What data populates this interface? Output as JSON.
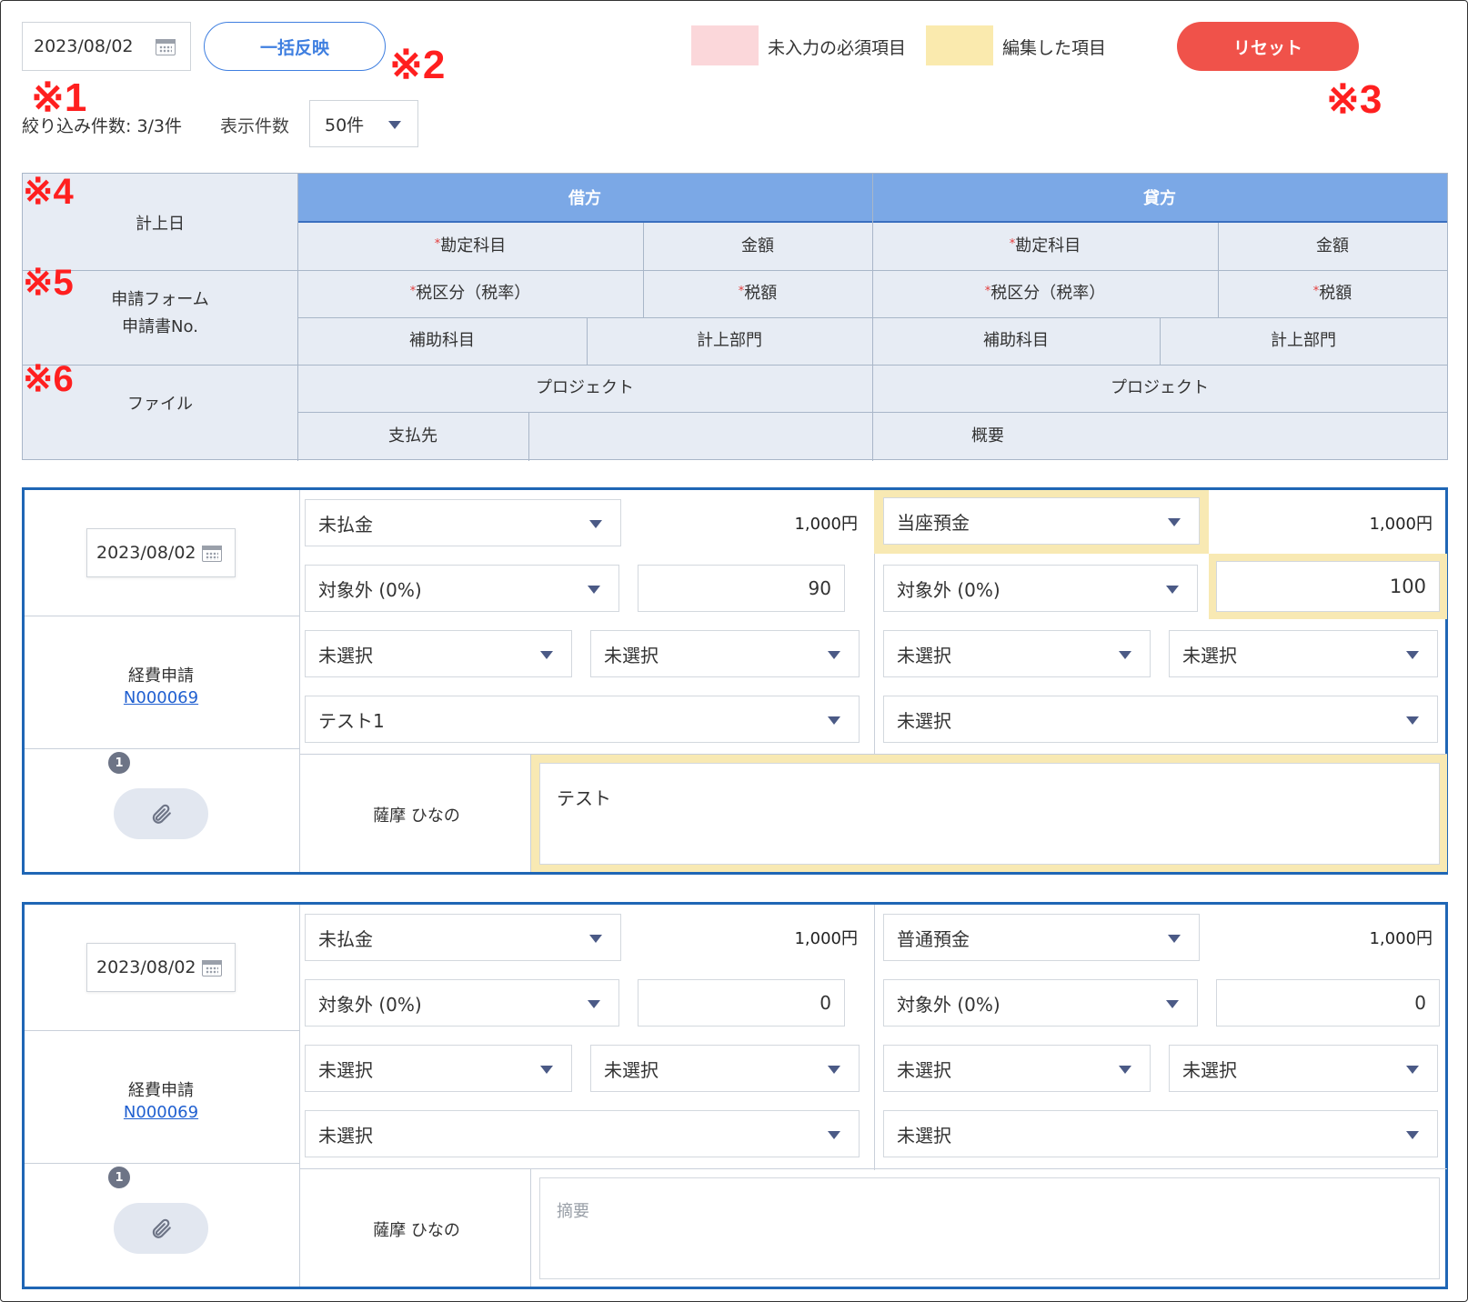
{
  "toolbar": {
    "bulk_date": "2023/08/02",
    "bulk_apply_label": "一括反映",
    "legend_required_label": "未入力の必須項目",
    "legend_edited_label": "編集した項目",
    "reset_label": "リセット",
    "filter_count": "絞り込み件数: 3/3件",
    "display_count_label": "表示件数",
    "display_count_value": "50件"
  },
  "notes": {
    "n1": "※1",
    "n2": "※2",
    "n3": "※3",
    "n4": "※4",
    "n5": "※5",
    "n6": "※6"
  },
  "colors": {
    "required": "#fbd7da",
    "edited": "#faeaae",
    "reset": "#f0524a",
    "accent": "#3f7fe0",
    "header_blue": "#7ba8e6"
  },
  "header": {
    "posting_date": "計上日",
    "debit": "借方",
    "credit": "貸方",
    "account": "勘定科目",
    "amount": "金額",
    "tax_category": "税区分（税率）",
    "tax_amount": "税額",
    "sub_account": "補助科目",
    "department": "計上部門",
    "form_line1": "申請フォーム",
    "form_line2": "申請書No.",
    "project": "プロジェクト",
    "file": "ファイル",
    "payee": "支払先",
    "summary": "概要",
    "required_mark": "*"
  },
  "rows": [
    {
      "date": "2023/08/02",
      "form_type": "経費申請",
      "form_no": "N000069",
      "attachment_count": "1",
      "debit": {
        "account": "未払金",
        "amount": "1,000円",
        "tax_category": "対象外 (0%)",
        "tax_amount": "90",
        "sub_account": "未選択",
        "department": "未選択",
        "project": "テスト1"
      },
      "credit": {
        "account": "当座預金",
        "amount": "1,000円",
        "tax_category": "対象外 (0%)",
        "tax_amount": "100",
        "sub_account": "未選択",
        "department": "未選択",
        "project": "未選択"
      },
      "payee": "薩摩 ひなの",
      "summary": "テスト"
    },
    {
      "date": "2023/08/02",
      "form_type": "経費申請",
      "form_no": "N000069",
      "attachment_count": "1",
      "debit": {
        "account": "未払金",
        "amount": "1,000円",
        "tax_category": "対象外 (0%)",
        "tax_amount": "0",
        "sub_account": "未選択",
        "department": "未選択",
        "project": "未選択"
      },
      "credit": {
        "account": "普通預金",
        "amount": "1,000円",
        "tax_category": "対象外 (0%)",
        "tax_amount": "0",
        "sub_account": "未選択",
        "department": "未選択",
        "project": "未選択"
      },
      "payee": "薩摩 ひなの",
      "summary_placeholder": "摘要"
    }
  ]
}
